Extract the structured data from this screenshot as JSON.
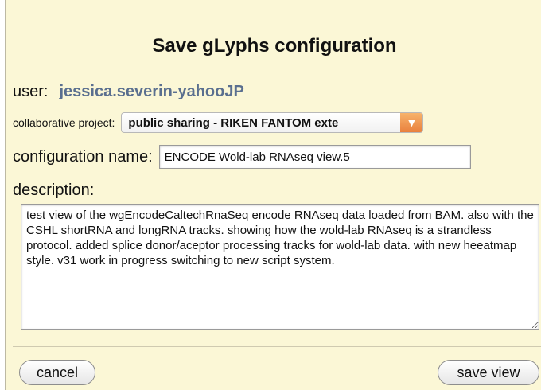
{
  "dialog": {
    "title": "Save gLyphs configuration",
    "user": {
      "label": "user:",
      "value": "jessica.severin-yahooJP"
    },
    "project": {
      "label": "collaborative project:",
      "selected": "public sharing - RIKEN FANTOM exte",
      "arrow_icon": "chevron-down-icon"
    },
    "config_name": {
      "label": "configuration name:",
      "value": "ENCODE Wold-lab RNAseq view.5"
    },
    "description": {
      "label": "description:",
      "value": "test view of the wgEncodeCaltechRnaSeq encode RNAseq data loaded from BAM. also with the CSHL shortRNA and longRNA tracks. showing how the wold-lab RNAseq is a strandless protocol. added splice donor/aceptor processing tracks for wold-lab data. with new heeatmap style. v31 work in progress switching to new script system."
    },
    "buttons": {
      "cancel": "cancel",
      "save": "save view"
    },
    "colors": {
      "background": "#fbf7d6",
      "user_value": "#5a6f8f",
      "select_arrow": "#e9803d"
    }
  }
}
